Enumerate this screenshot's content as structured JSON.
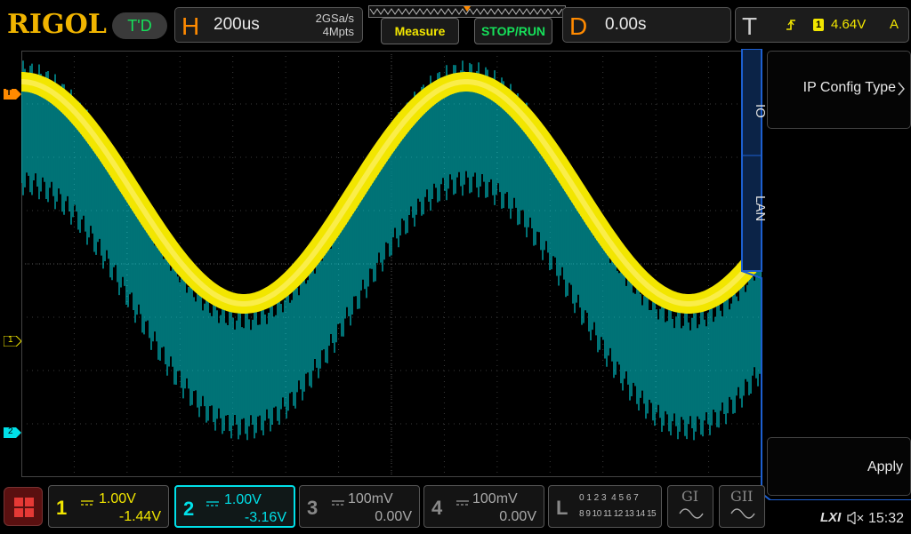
{
  "brand": "RIGOL",
  "run_state": "T'D",
  "horizontal": {
    "letter": "H",
    "timebase": "200us",
    "sample_rate": "2GSa/s",
    "memory_depth": "4Mpts"
  },
  "buttons": {
    "measure": "Measure",
    "stop_run": "STOP/RUN"
  },
  "delay": {
    "letter": "D",
    "value": "0.00s"
  },
  "trigger": {
    "letter": "T",
    "source": "1",
    "level": "4.64V",
    "mode": "A"
  },
  "side_menu": {
    "tabs": [
      "IO",
      "LAN"
    ],
    "ip_config_label": "IP Config Type",
    "apply_label": "Apply"
  },
  "markers": {
    "trigger_marker": "T",
    "ch1_marker": "1",
    "ch2_marker": "2"
  },
  "channels": [
    {
      "num": "1",
      "scale": "1.00V",
      "offset": "-1.44V",
      "color": "#f2e600",
      "active": false
    },
    {
      "num": "2",
      "scale": "1.00V",
      "offset": "-3.16V",
      "color": "#00e0e8",
      "active": true
    },
    {
      "num": "3",
      "scale": "100mV",
      "offset": "0.00V",
      "color": "#888888",
      "active": false
    },
    {
      "num": "4",
      "scale": "100mV",
      "offset": "0.00V",
      "color": "#888888",
      "active": false
    }
  ],
  "logic": {
    "letter": "L",
    "row1": "0 1 2 3  4 5 6 7",
    "row2": "8 9 10 11 12 13 14 15"
  },
  "generators": [
    "GI",
    "GII"
  ],
  "status": {
    "lxi": "LXI",
    "clock": "15:32"
  },
  "colors": {
    "ch1": "#f2e600",
    "ch2": "#00e0e8",
    "accent": "#ff8a00",
    "menu_blue": "#1d5fd0"
  }
}
